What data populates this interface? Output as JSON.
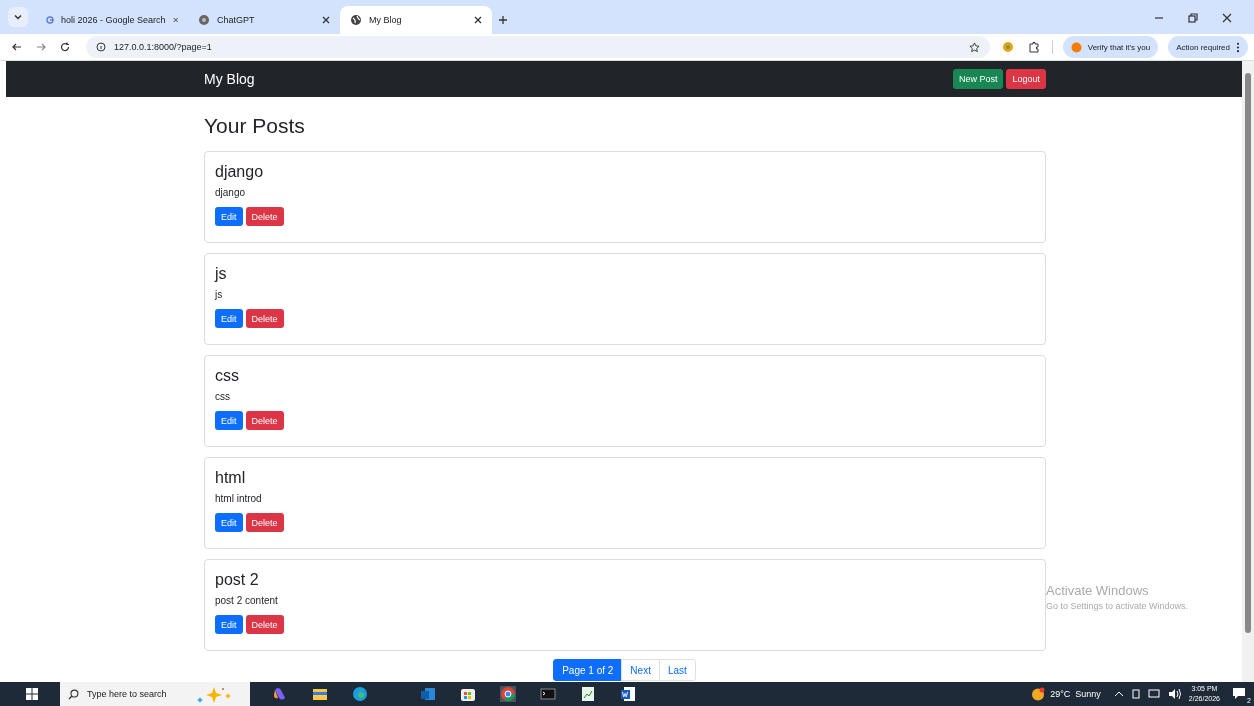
{
  "browser": {
    "tabs": [
      {
        "title": "holi 2026 - Google Search",
        "selected": false
      },
      {
        "title": "ChatGPT",
        "selected": false
      },
      {
        "title": "My Blog",
        "selected": true
      }
    ],
    "url": "127.0.0.1:8000/?page=1",
    "profile_chip": "Verify that it's you",
    "action_chip": "Action required"
  },
  "navbar": {
    "brand": "My Blog",
    "buttons": [
      {
        "label": "New Post",
        "kind": "success"
      },
      {
        "label": "Logout",
        "kind": "danger"
      }
    ]
  },
  "heading": "Your Posts",
  "posts": [
    {
      "title": "django",
      "body": "django",
      "actions": [
        "Edit",
        "Delete"
      ]
    },
    {
      "title": "js",
      "body": "js",
      "actions": [
        "Edit",
        "Delete"
      ]
    },
    {
      "title": "css",
      "body": "css",
      "actions": [
        "Edit",
        "Delete"
      ]
    },
    {
      "title": "html",
      "body": "html introd",
      "actions": [
        "Edit",
        "Delete"
      ]
    },
    {
      "title": "post 2",
      "body": "post 2 content",
      "actions": [
        "Edit",
        "Delete"
      ]
    }
  ],
  "pagination": [
    {
      "label": "Page 1 of 2",
      "selected": true
    },
    {
      "label": "Next",
      "selected": false
    },
    {
      "label": "Last",
      "selected": false
    }
  ],
  "activation_notice": {
    "title": "Activate Windows",
    "text": "Go to Settings to activate Windows."
  },
  "taskbar": {
    "search_placeholder": "Type here to search",
    "weather": "29°C  Sunny",
    "time": "3:05 PM",
    "date": "2/26/2026",
    "notifications": "2"
  }
}
